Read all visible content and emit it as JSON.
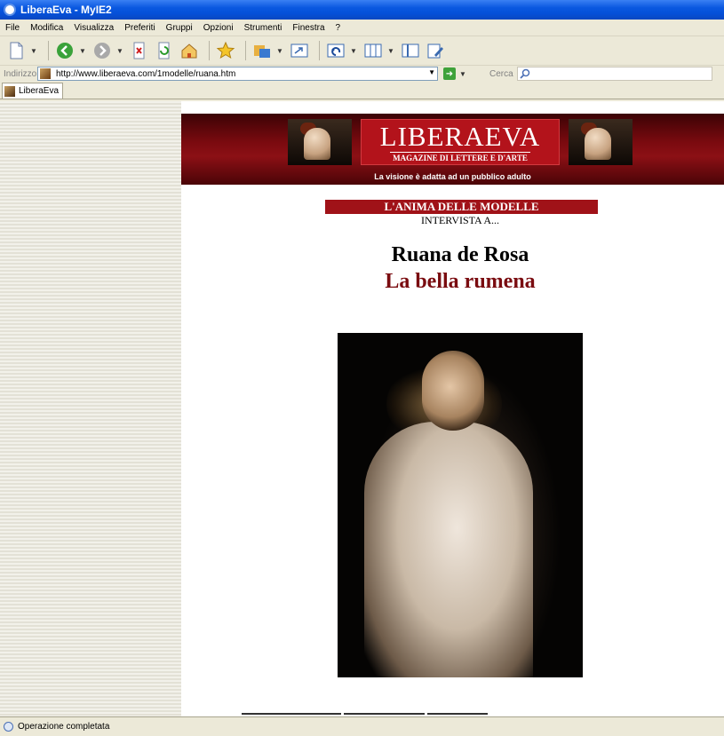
{
  "window": {
    "title": "LiberaEva - MyIE2"
  },
  "menu": [
    "File",
    "Modifica",
    "Visualizza",
    "Preferiti",
    "Gruppi",
    "Opzioni",
    "Strumenti",
    "Finestra",
    "?"
  ],
  "address": {
    "label": "Indirizzo",
    "url": "http://www.liberaeva.com/1modelle/ruana.htm"
  },
  "search": {
    "label": "Cerca"
  },
  "tabs": [
    {
      "label": "LiberaEva"
    }
  ],
  "page": {
    "logo_title": "LIBERAEVA",
    "logo_subtitle": "MAGAZINE DI LETTERE E D'ARTE",
    "adult_note": "La visione è adatta ad un pubblico adulto",
    "section": "L'ANIMA DELLE MODELLE",
    "intervista": "INTERVISTA  A...",
    "name": "Ruana de Rosa",
    "subtitle": "La bella rumena"
  },
  "status": {
    "text": "Operazione completata"
  },
  "colors": {
    "brand_red": "#b3131b",
    "title_red": "#7a0c10",
    "titlebar_blue": "#0a58e0"
  }
}
